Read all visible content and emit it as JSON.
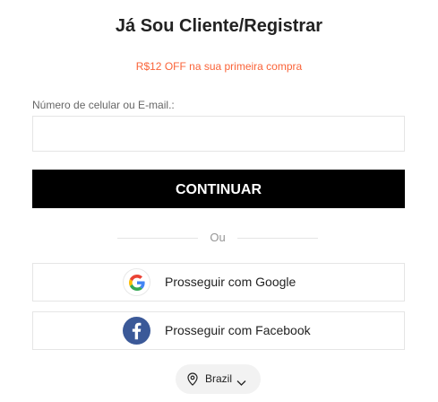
{
  "header": {
    "title": "Já Sou Cliente/Registrar",
    "promo": "R$12 OFF na sua primeira compra"
  },
  "login_form": {
    "field_label": "Número de celular ou E-mail.:",
    "field_value": "",
    "continue_label": "CONTINUAR"
  },
  "divider": {
    "text": "Ou"
  },
  "social": {
    "google_label": "Prosseguir com Google",
    "facebook_label": "Prosseguir com Facebook",
    "google_icon": "google-icon",
    "facebook_icon": "facebook-icon"
  },
  "country_selector": {
    "label": "Brazil",
    "icon": "location-pin-icon"
  },
  "colors": {
    "promo": "#fa6338",
    "primary_button": "#000000",
    "facebook_blue": "#3b5998"
  }
}
